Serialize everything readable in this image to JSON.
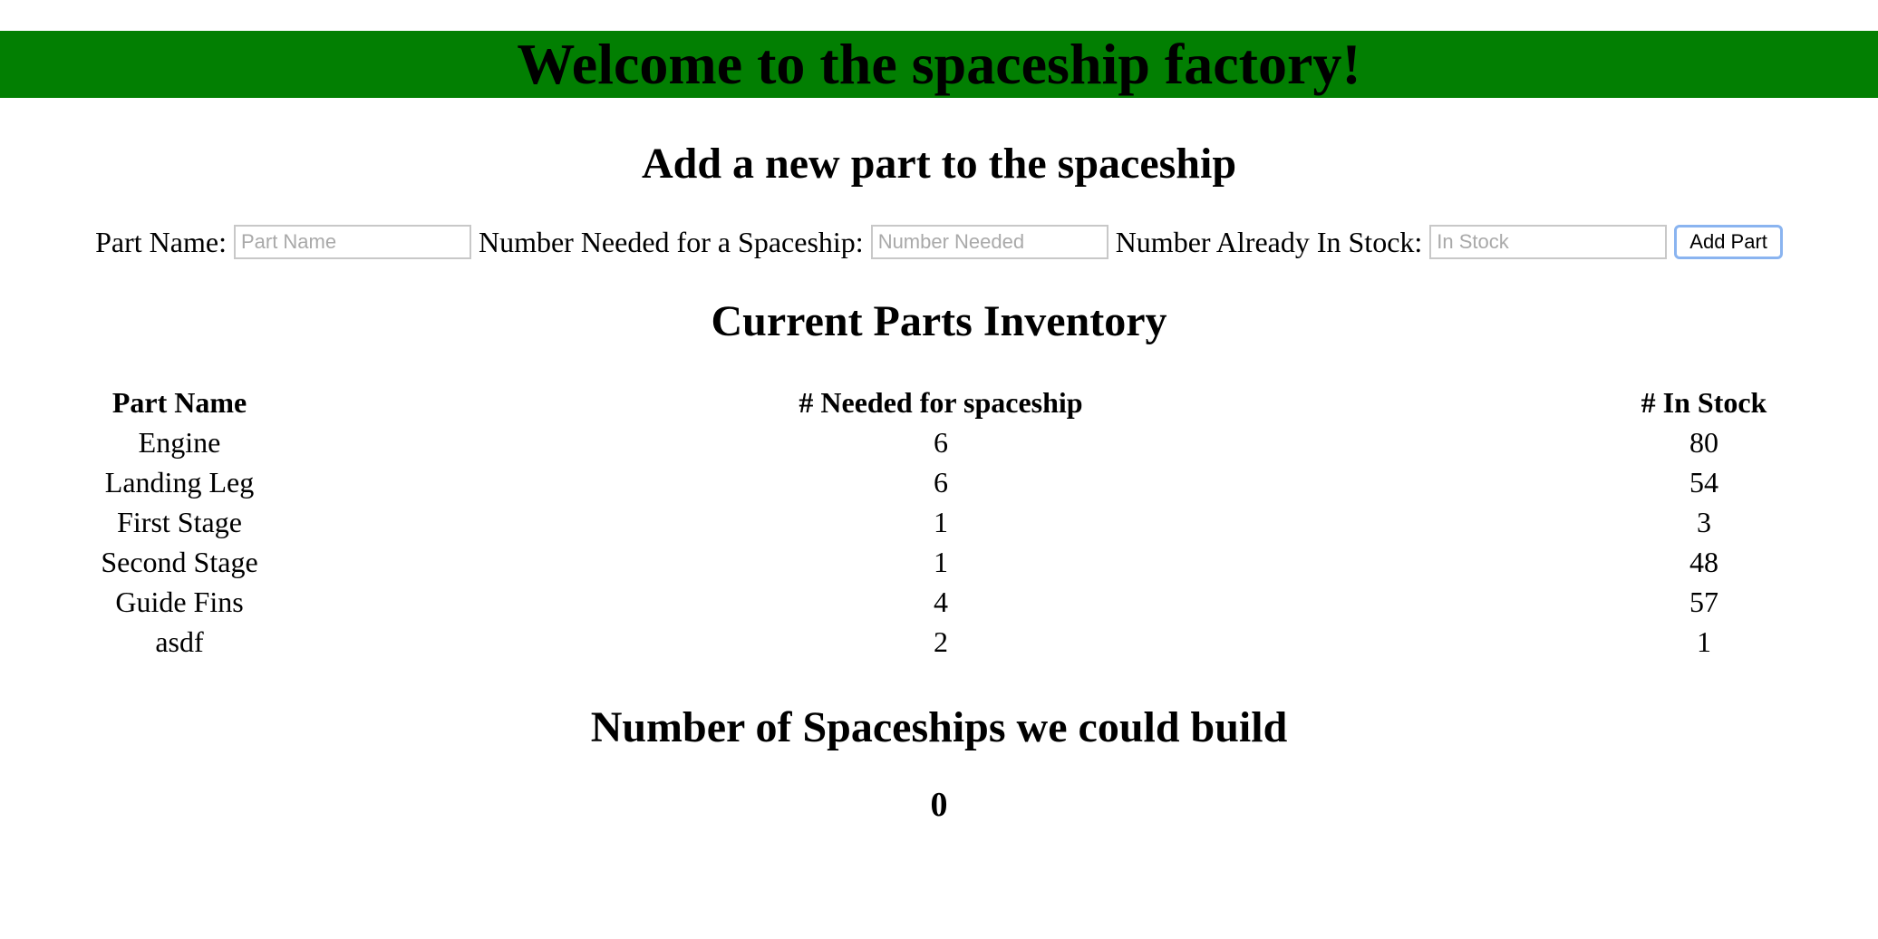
{
  "banner": {
    "title": "Welcome to the spaceship factory!",
    "color": "#027f02"
  },
  "add_part": {
    "heading": "Add a new part to the spaceship",
    "part_name_label": "Part Name:",
    "part_name_placeholder": "Part Name",
    "part_name_value": "",
    "needed_label": "Number Needed for a Spaceship:",
    "needed_placeholder": "Number Needed",
    "needed_value": "",
    "stock_label": "Number Already In Stock:",
    "stock_placeholder": "In Stock",
    "stock_value": "",
    "button_label": "Add Part"
  },
  "inventory": {
    "heading": "Current Parts Inventory",
    "columns": [
      "Part Name",
      "# Needed for spaceship",
      "# In Stock"
    ],
    "rows": [
      {
        "name": "Engine",
        "needed": "6",
        "stock": "80"
      },
      {
        "name": "Landing Leg",
        "needed": "6",
        "stock": "54"
      },
      {
        "name": "First Stage",
        "needed": "1",
        "stock": "3"
      },
      {
        "name": "Second Stage",
        "needed": "1",
        "stock": "48"
      },
      {
        "name": "Guide Fins",
        "needed": "4",
        "stock": "57"
      },
      {
        "name": "asdf",
        "needed": "2",
        "stock": "1"
      }
    ]
  },
  "buildable": {
    "heading": "Number of Spaceships we could build",
    "value": "0"
  }
}
